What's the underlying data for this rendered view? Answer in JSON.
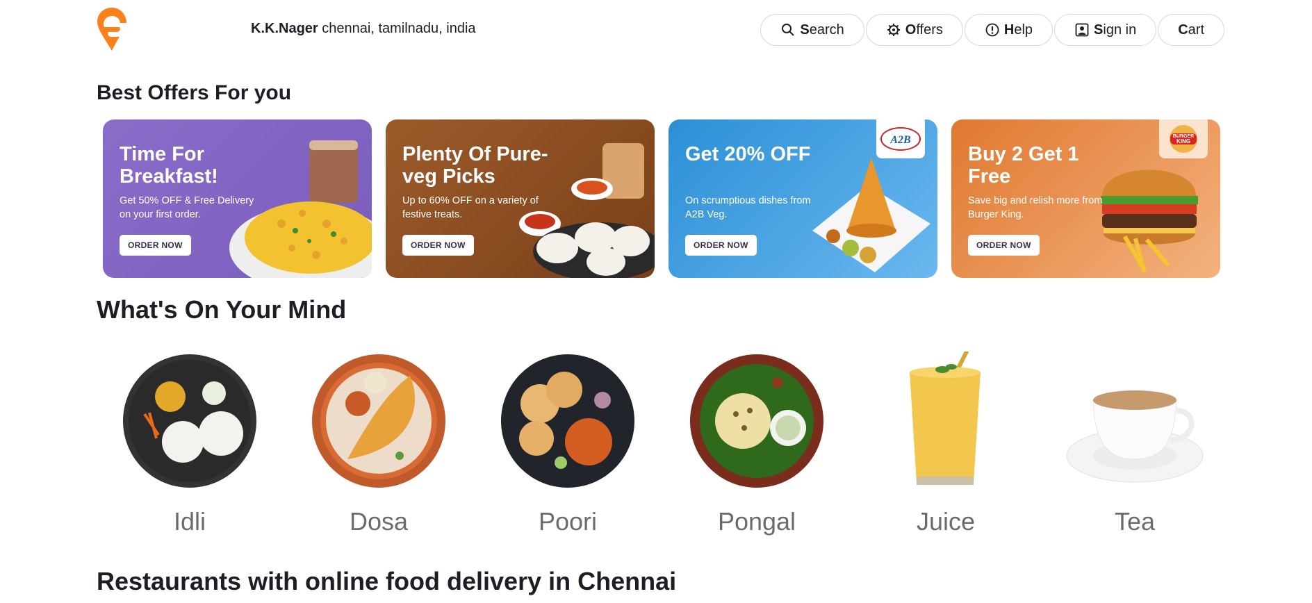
{
  "header": {
    "location_area": "K.K.Nager",
    "location_rest": "chennai, tamilnadu, india",
    "nav": [
      {
        "label": "Search",
        "icon": "search-icon"
      },
      {
        "label": "Offers",
        "icon": "gear-icon"
      },
      {
        "label": "Help",
        "icon": "help-icon"
      },
      {
        "label": "Sign in",
        "icon": "user-icon"
      },
      {
        "label": "Cart",
        "icon": ""
      }
    ]
  },
  "sections": {
    "offers_title": "Best Offers For you",
    "mind_title": "What's On Your Mind",
    "restaurants_title": "Restaurants with online food delivery in Chennai"
  },
  "offers": [
    {
      "title": "Time For Breakfast!",
      "desc": "Get 50% OFF & Free Delivery on your first order.",
      "cta": "ORDER NOW",
      "color": "#8a6cc9"
    },
    {
      "title": "Plenty Of Pure-veg Picks",
      "desc": "Up to 60% OFF on a variety of festive treats.",
      "cta": "ORDER NOW",
      "color": "#9c5b2a"
    },
    {
      "title": "Get 20% OFF",
      "desc": "On scrumptious dishes from A2B Veg.",
      "cta": "ORDER NOW",
      "color": "#2b8fd6",
      "brand": "A2B"
    },
    {
      "title": "Buy 2 Get 1 Free",
      "desc": "Save big and relish more from Burger King.",
      "cta": "ORDER NOW",
      "color": "#e07830",
      "brand": "BURGER KING"
    }
  ],
  "mind_items": [
    "Idli",
    "Dosa",
    "Poori",
    "Pongal",
    "Juice",
    "Tea"
  ],
  "colors": {
    "brand": "#fc8019",
    "text": "#1b1e24"
  }
}
